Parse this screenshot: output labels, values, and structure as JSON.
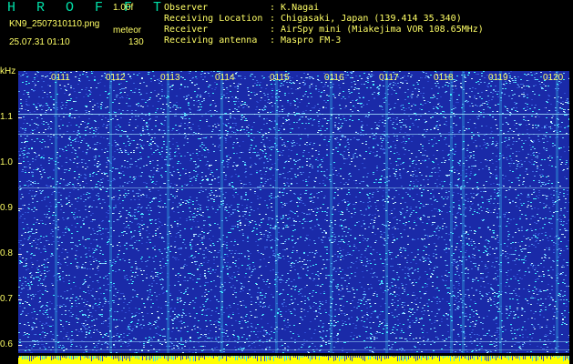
{
  "header": {
    "logo": "H R O F F T",
    "version": "1.00f",
    "filename": "KN9_2507310110.png",
    "mode": "meteor",
    "datetime": "25.07.31 01:10",
    "count": "130"
  },
  "info": [
    {
      "key": "Observer",
      "value": ": K.Nagai"
    },
    {
      "key": "Receiving Location",
      "value": ": Chigasaki, Japan (139.414 35.340)"
    },
    {
      "key": "Receiver",
      "value": ": AirSpy mini (Miakejima VOR 108.65MHz)"
    },
    {
      "key": "Receiving antenna",
      "value": ": Maspro FM-3"
    }
  ],
  "axis": {
    "unit": "kHz",
    "y_labels": [
      "1.1",
      "1.0",
      "0.9",
      "0.8",
      "0.7",
      "0.6"
    ],
    "time_labels": [
      "0111",
      "0112",
      "0113",
      "0114",
      "0115",
      "0116",
      "0117",
      "0118",
      "0119",
      "0120"
    ]
  },
  "colors": {
    "background": "#000000",
    "text": "#ffff66",
    "logo": "#00e0a8",
    "plot_bg": "#1a2aa8",
    "noise_light": "#6fd0ff",
    "noise_cyan": "#40f0ff",
    "bottom_strip": "#ffff00"
  }
}
